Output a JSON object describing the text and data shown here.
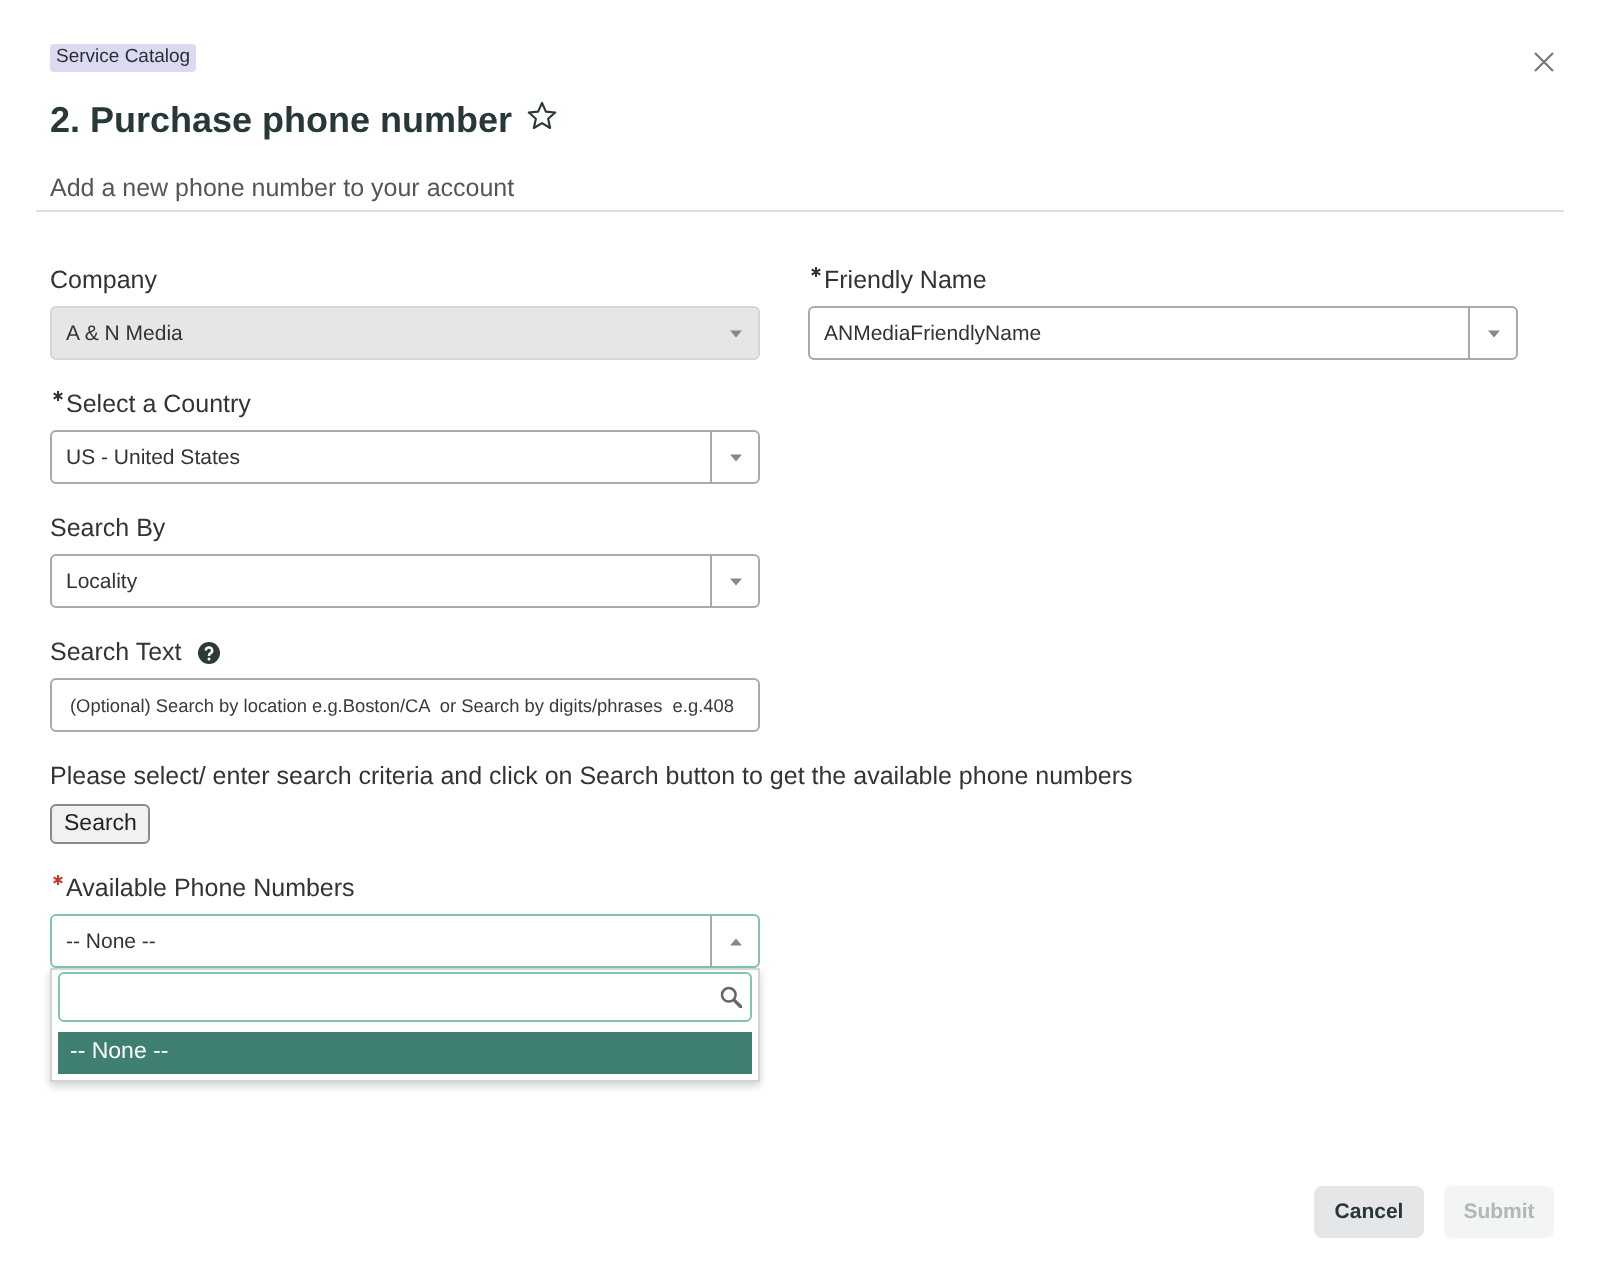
{
  "header": {
    "tag": "Service Catalog",
    "title": "2. Purchase phone number",
    "starred": false,
    "subtitle": "Add a new phone number to your account"
  },
  "form": {
    "rows": [
      [
        {
          "kind": "select",
          "label": "Company",
          "disabled": true,
          "open": false,
          "value": "A & N Media"
        },
        {
          "kind": "select",
          "label": "Friendly Name",
          "required": true,
          "satisfied": true,
          "disabled": false,
          "open": false,
          "value": "ANMediaFriendlyName"
        }
      ],
      [
        {
          "kind": "select",
          "label": "Select a Country",
          "required": true,
          "satisfied": true,
          "disabled": false,
          "open": false,
          "value": "US - United States"
        }
      ],
      [
        {
          "kind": "select",
          "label": "Search By",
          "disabled": false,
          "open": false,
          "value": "Locality"
        }
      ],
      [
        {
          "kind": "text",
          "label": "Search Text",
          "help": true,
          "disabled": false,
          "placeholder": "(Optional) Search by location e.g.Boston/CA  or Search by digits/phrases  e.g.408"
        }
      ]
    ],
    "instruction": "Please select/ enter search criteria and click on Search button to get the available phone numbers",
    "search_button": "Search",
    "phone_numbers": {
      "kind": "select",
      "label": "Available Phone Numbers",
      "required": true,
      "satisfied": false,
      "disabled": false,
      "open": true,
      "value": "-- None --",
      "options": [
        {
          "label": "-- None --",
          "selected": true
        }
      ]
    }
  },
  "footer": {
    "buttons": [
      {
        "label": "Cancel",
        "disabled": false
      },
      {
        "label": "Submit",
        "disabled": true
      }
    ]
  }
}
